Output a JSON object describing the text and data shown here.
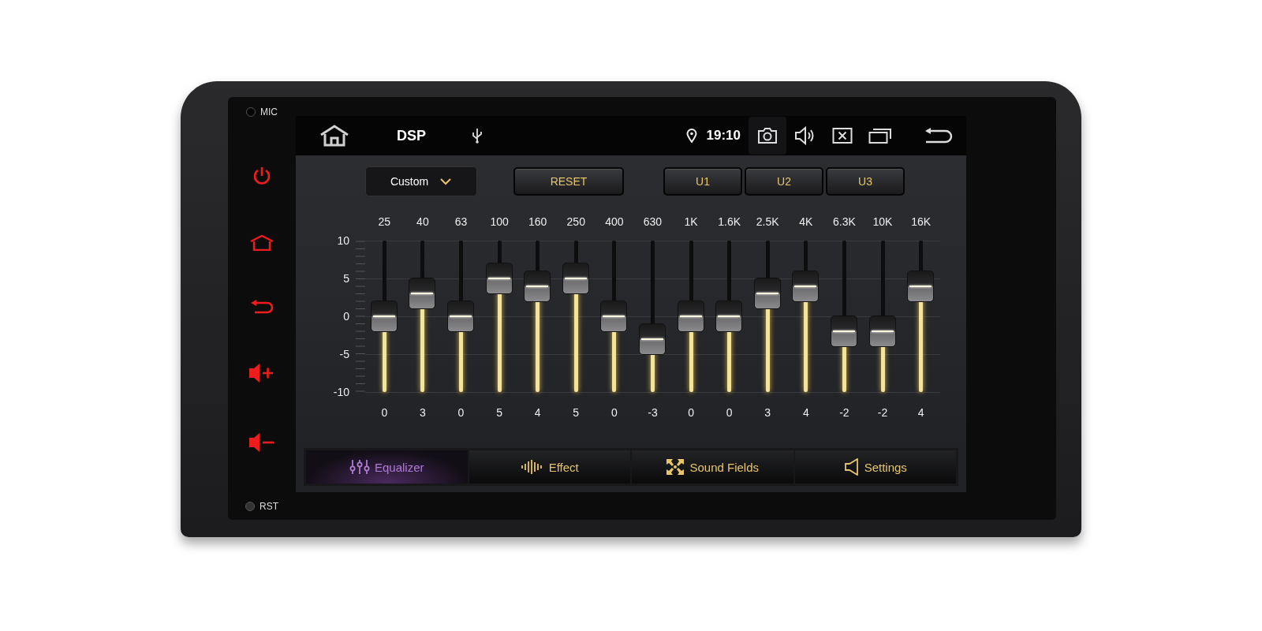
{
  "side_panel": {
    "mic_label": "MIC",
    "reset_label": "RST",
    "keys": [
      {
        "kind": "power"
      },
      {
        "kind": "home"
      },
      {
        "kind": "back"
      },
      {
        "kind": "volume_up"
      },
      {
        "kind": "volume_down"
      }
    ]
  },
  "status_bar": {
    "title": "DSP",
    "time": "19:10"
  },
  "controls": {
    "preset": "Custom",
    "reset": "RESET",
    "user_presets": [
      "U1",
      "U2",
      "U3"
    ]
  },
  "y_axis": [
    "10",
    "5",
    "0",
    "-5",
    "-10"
  ],
  "bands": [
    {
      "freq": "25",
      "value": "0",
      "level": 0.5
    },
    {
      "freq": "40",
      "value": "3",
      "level": 0.65
    },
    {
      "freq": "63",
      "value": "0",
      "level": 0.5
    },
    {
      "freq": "100",
      "value": "5",
      "level": 0.75
    },
    {
      "freq": "160",
      "value": "4",
      "level": 0.7
    },
    {
      "freq": "250",
      "value": "5",
      "level": 0.75
    },
    {
      "freq": "400",
      "value": "0",
      "level": 0.5
    },
    {
      "freq": "630",
      "value": "-3",
      "level": 0.35
    },
    {
      "freq": "1K",
      "value": "0",
      "level": 0.5
    },
    {
      "freq": "1.6K",
      "value": "0",
      "level": 0.5
    },
    {
      "freq": "2.5K",
      "value": "3",
      "level": 0.65
    },
    {
      "freq": "4K",
      "value": "4",
      "level": 0.7
    },
    {
      "freq": "6.3K",
      "value": "-2",
      "level": 0.4
    },
    {
      "freq": "10K",
      "value": "-2",
      "level": 0.4
    },
    {
      "freq": "16K",
      "value": "4",
      "level": 0.7
    }
  ],
  "tabs": [
    {
      "label": "Equalizer",
      "kind": "equalizer",
      "selected": true
    },
    {
      "label": "Effect",
      "kind": "effect",
      "selected": false
    },
    {
      "label": "Sound Fields",
      "kind": "fields",
      "selected": false
    },
    {
      "label": "Settings",
      "kind": "settings",
      "selected": false
    }
  ]
}
